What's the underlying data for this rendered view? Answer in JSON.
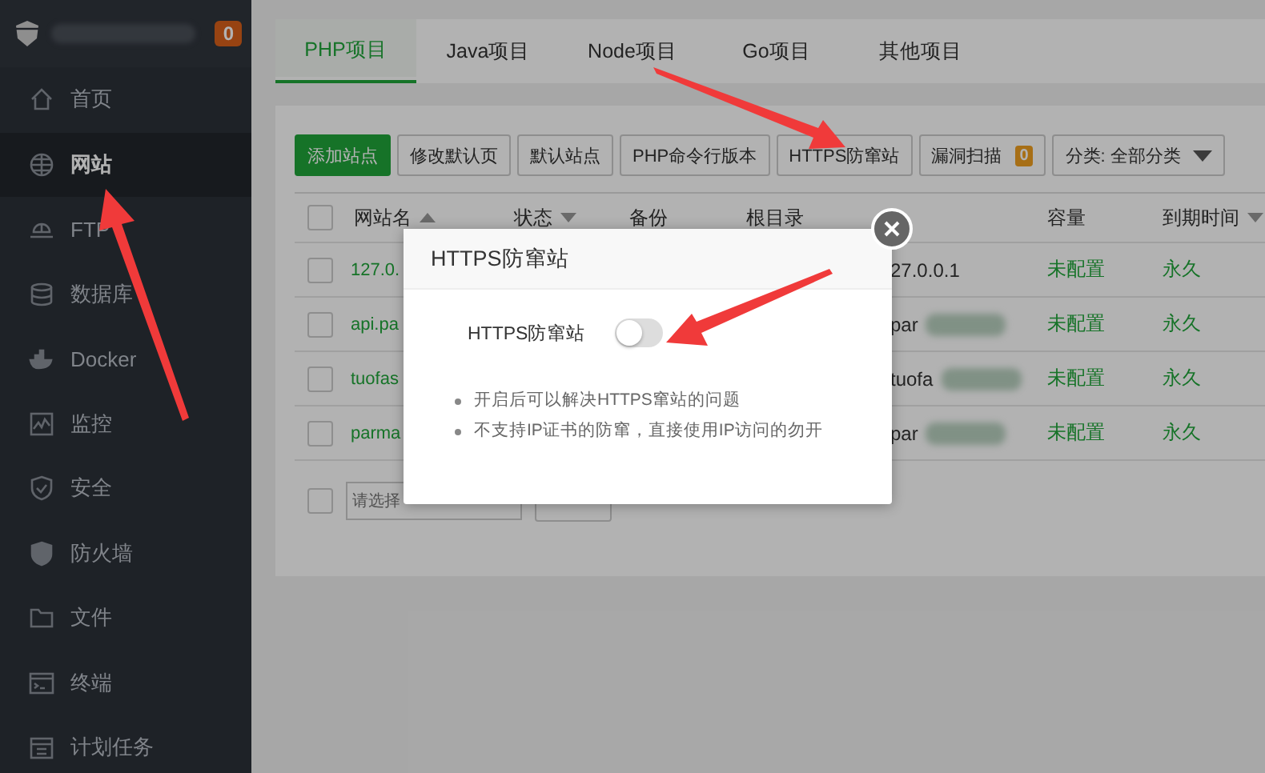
{
  "sidebar": {
    "badge": "0",
    "items": [
      {
        "label": "首页",
        "selected": false
      },
      {
        "label": "网站",
        "selected": true
      },
      {
        "label": "FTP",
        "selected": false
      },
      {
        "label": "数据库",
        "selected": false
      },
      {
        "label": "Docker",
        "selected": false
      },
      {
        "label": "监控",
        "selected": false
      },
      {
        "label": "安全",
        "selected": false
      },
      {
        "label": "防火墙",
        "selected": false
      },
      {
        "label": "文件",
        "selected": false
      },
      {
        "label": "终端",
        "selected": false
      },
      {
        "label": "计划任务",
        "selected": false
      }
    ]
  },
  "tabs": [
    {
      "label": "PHP项目",
      "selected": true
    },
    {
      "label": "Java项目",
      "selected": false
    },
    {
      "label": "Node项目",
      "selected": false
    },
    {
      "label": "Go项目",
      "selected": false
    },
    {
      "label": "其他项目",
      "selected": false
    }
  ],
  "toolbar": {
    "buttons": [
      {
        "label": "添加站点",
        "kind": "primary"
      },
      {
        "label": "修改默认页",
        "kind": "default"
      },
      {
        "label": "默认站点",
        "kind": "default"
      },
      {
        "label": "PHP命令行版本",
        "kind": "default"
      },
      {
        "label": "HTTPS防窜站",
        "kind": "default"
      },
      {
        "label": "漏洞扫描",
        "kind": "count",
        "count": "0"
      },
      {
        "label": "分类: 全部分类",
        "kind": "dropdown"
      }
    ]
  },
  "table": {
    "all_checked": false,
    "columns": [
      {
        "label": "网站名",
        "sort_ascending": true
      },
      {
        "label": "状态",
        "sort_ascending": false
      },
      {
        "label": "备份"
      },
      {
        "label": "根目录"
      },
      {
        "label": "容量"
      },
      {
        "label": "到期时间",
        "sort_ascending": false
      }
    ],
    "rows": [
      {
        "checked": false,
        "name": "127.0.",
        "column_5": "27.0.0.1",
        "capacity": "未配置",
        "expiry": "永久"
      },
      {
        "checked": false,
        "name": "api.pa",
        "column_5": "par",
        "capacity": "未配置",
        "expiry": "永久"
      },
      {
        "checked": false,
        "name": "tuofas",
        "column_5": "tuofa",
        "capacity": "未配置",
        "expiry": "永久"
      },
      {
        "checked": false,
        "name": "parma",
        "column_5": "par",
        "capacity": "未配置",
        "expiry": "永久"
      }
    ]
  },
  "footer": {
    "checked": false,
    "select_placeholder": "请选择"
  },
  "modal": {
    "title": "HTTPS防窜站",
    "toggle": {
      "label": "HTTPS防窜站",
      "on": false
    },
    "notes": [
      "开启后可以解决HTTPS窜站的问题",
      "不支持IP证书的防窜，直接使用IP访问的勿开"
    ]
  }
}
